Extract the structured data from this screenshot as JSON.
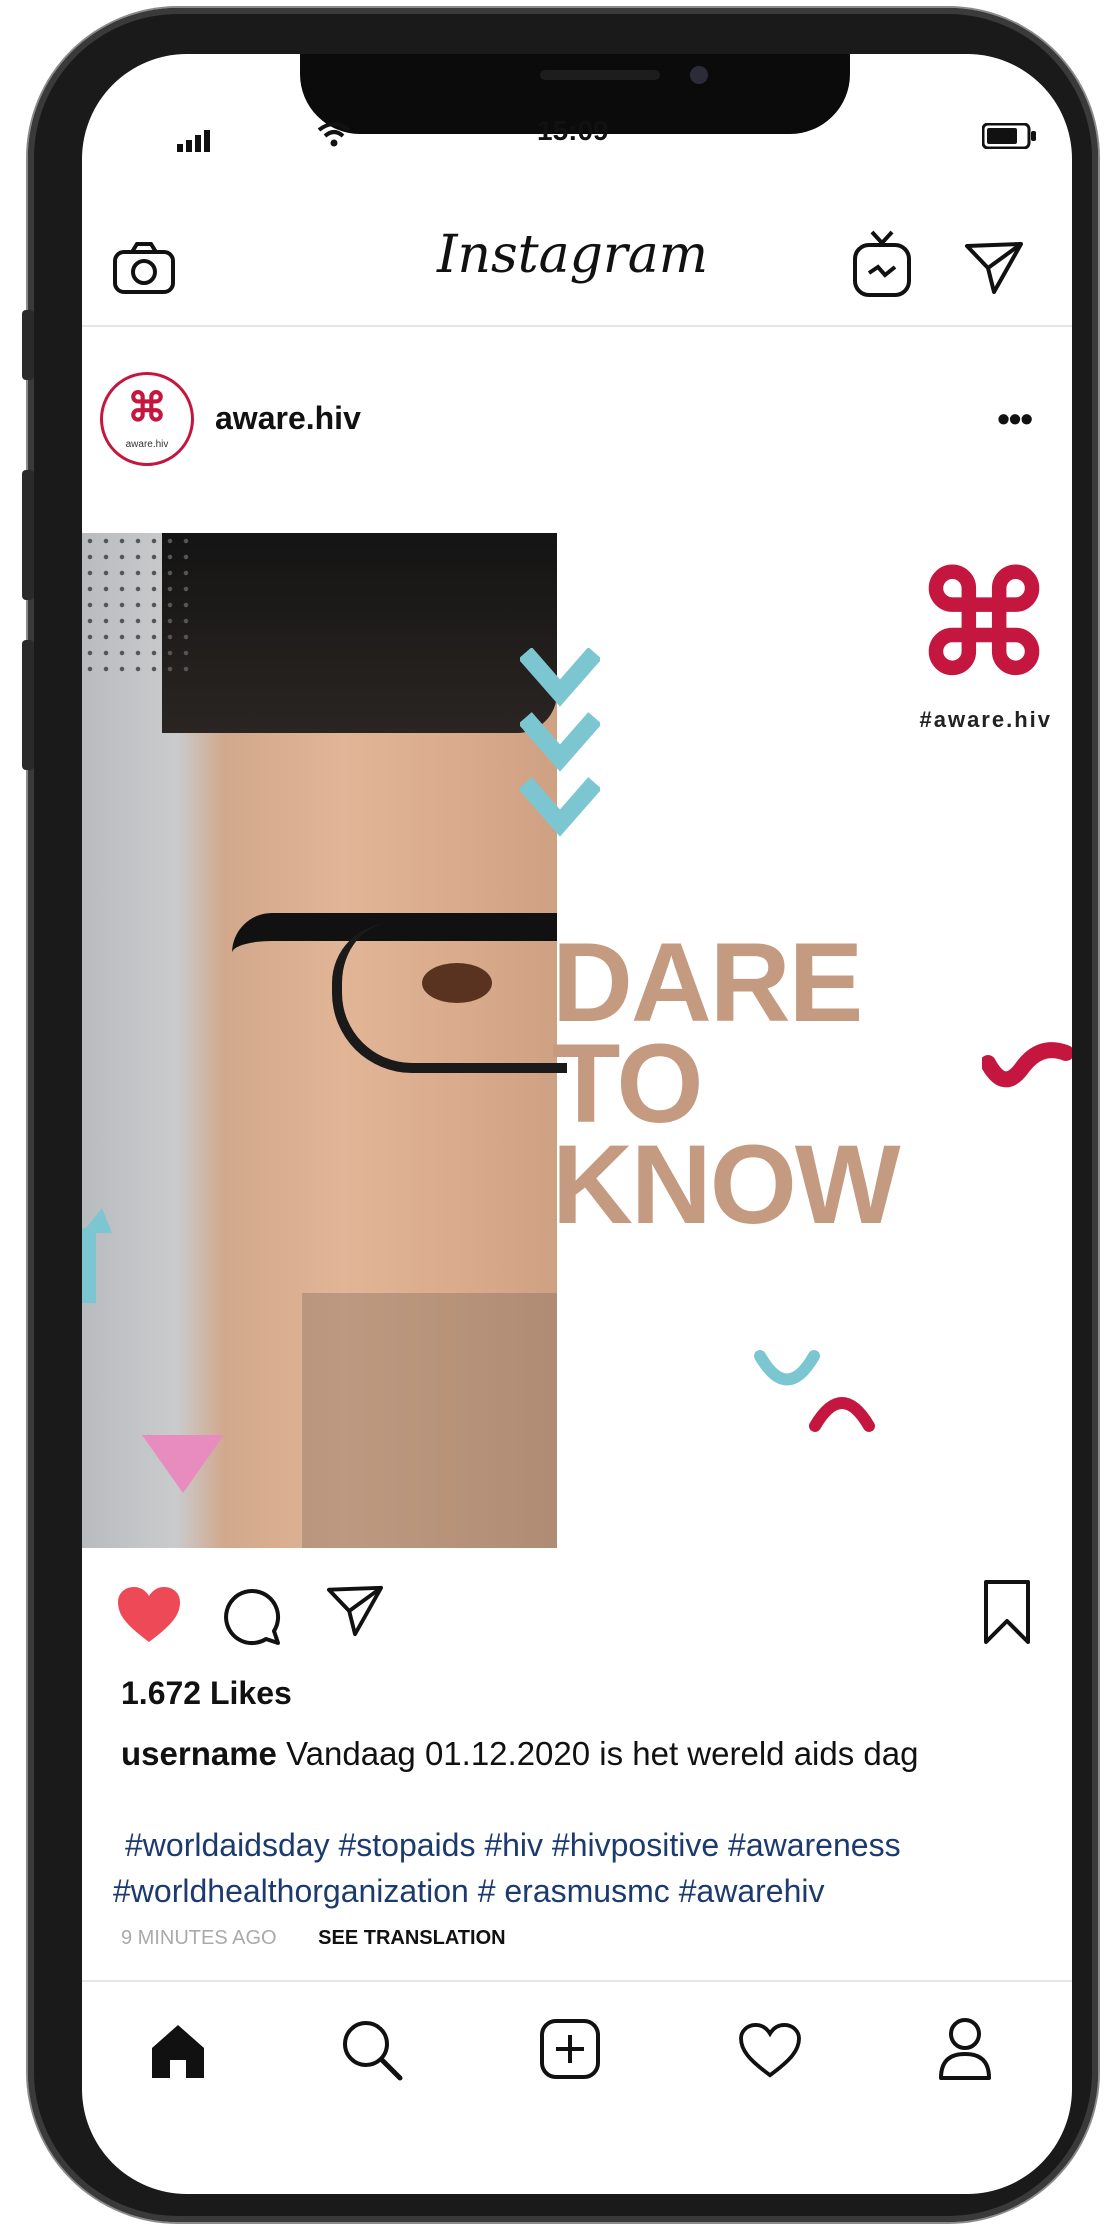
{
  "status_bar": {
    "time": "15:09"
  },
  "app": {
    "title": "Instagram"
  },
  "post": {
    "username": "aware.hiv",
    "more_label": "•••",
    "image": {
      "headline": [
        "DARE",
        "TO",
        "KNOW"
      ],
      "brand_tag": "#aware.hiv",
      "brand_symbol": "⌘"
    },
    "liked": true,
    "like_color": "#ed4956",
    "likes": "1.672 Likes",
    "caption_user": "username",
    "caption_text": " Vandaag 01.12.2020 is het wereld aids dag",
    "hashtags_line1": "#worldaidsday #stopaids #hiv #hivpositive #awareness",
    "hashtags_line2": "#worldhealthorganization # erasmusmc #awarehiv",
    "time_ago": "9 MINUTES AGO",
    "see_translation": "SEE TRANSLATION"
  },
  "icons": {
    "camera": "camera-icon",
    "igtv": "igtv-icon",
    "direct": "send-icon",
    "like": "heart-filled-icon",
    "comment": "comment-icon",
    "share": "send-icon",
    "save": "bookmark-icon",
    "home": "home-icon",
    "search": "search-icon",
    "add": "add-post-icon",
    "activity": "heart-icon",
    "profile": "profile-icon"
  },
  "colors": {
    "brand_red": "#c4163f",
    "hashtag": "#1c3a6e",
    "accent_cyan": "#7cc6d2",
    "accent_pink": "#e88cc0"
  }
}
